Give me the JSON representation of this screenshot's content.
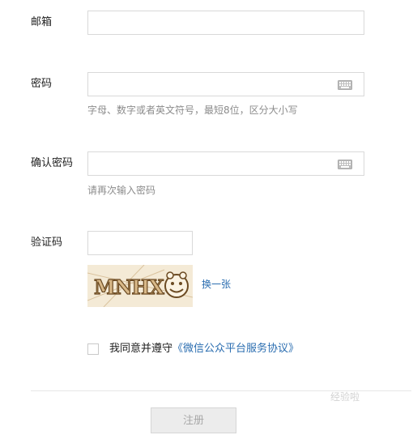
{
  "form": {
    "email": {
      "label": "邮箱",
      "value": ""
    },
    "password": {
      "label": "密码",
      "value": "",
      "hint": "字母、数字或者英文符号，最短8位，区分大小写",
      "keyboard_icon": "keyboard-icon"
    },
    "confirm": {
      "label": "确认密码",
      "value": "",
      "hint": "请再次输入密码",
      "keyboard_icon": "keyboard-icon"
    },
    "captcha": {
      "label": "验证码",
      "value": "",
      "image_text": "MNHX",
      "refresh_label": "换一张"
    },
    "agreement": {
      "text": "我同意并遵守",
      "link": "《微信公众平台服务协议》",
      "checked": false
    },
    "submit_label": "注册"
  },
  "watermark": "经验啦",
  "colors": {
    "link": "#2a6db0",
    "hint": "#8c8c8c",
    "border": "#d9d9d9"
  }
}
